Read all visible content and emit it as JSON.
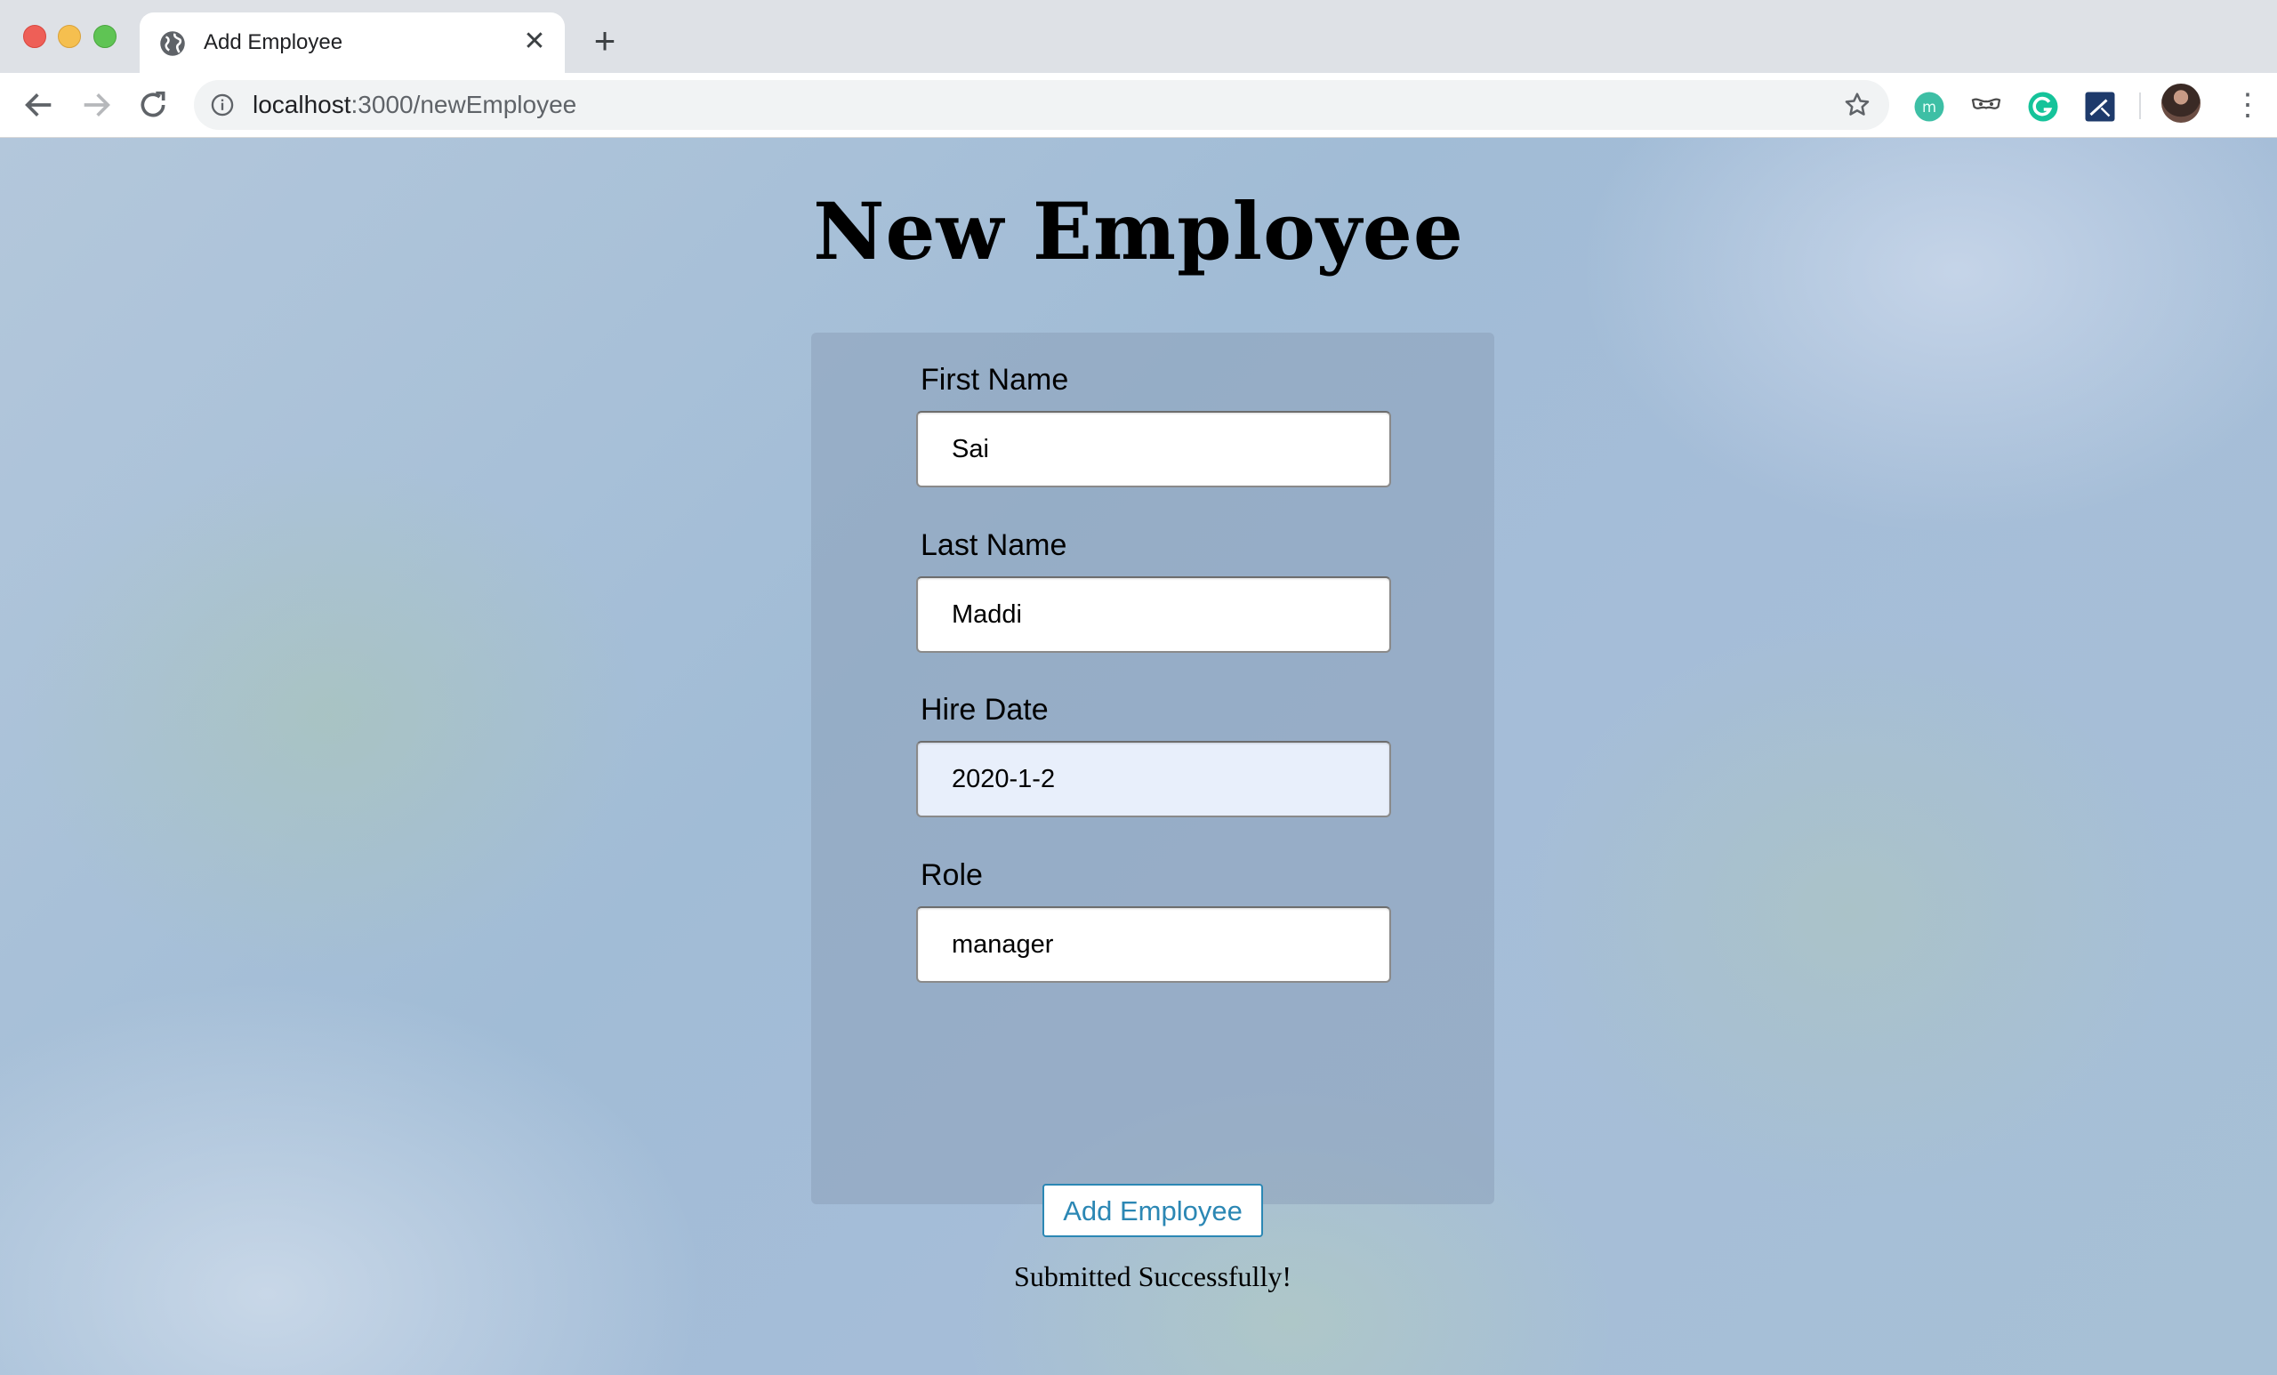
{
  "browser": {
    "tab_title": "Add Employee",
    "url_host": "localhost",
    "url_path": ":3000/newEmployee",
    "icons": {
      "back": "back-arrow-icon",
      "forward": "forward-arrow-icon",
      "reload": "reload-icon",
      "info": "info-icon",
      "bookmark": "star-icon",
      "close_tab": "close-icon",
      "new_tab": "plus-icon",
      "menu": "kebab-menu-icon"
    },
    "extensions": [
      "monica-extension-icon",
      "mask-extension-icon",
      "grammarly-extension-icon",
      "wand-extension-icon"
    ]
  },
  "page": {
    "heading": "New Employee",
    "form": {
      "first_name": {
        "label": "First Name",
        "value": "Sai"
      },
      "last_name": {
        "label": "Last Name",
        "value": "Maddi"
      },
      "hire_date": {
        "label": "Hire Date",
        "value": "2020-1-2"
      },
      "role": {
        "label": "Role",
        "value": "manager"
      },
      "submit_label": "Add Employee",
      "status_message": "Submitted Successfully!"
    }
  },
  "colors": {
    "button_accent": "#2b87b4",
    "autofill_bg": "#e8effb"
  }
}
